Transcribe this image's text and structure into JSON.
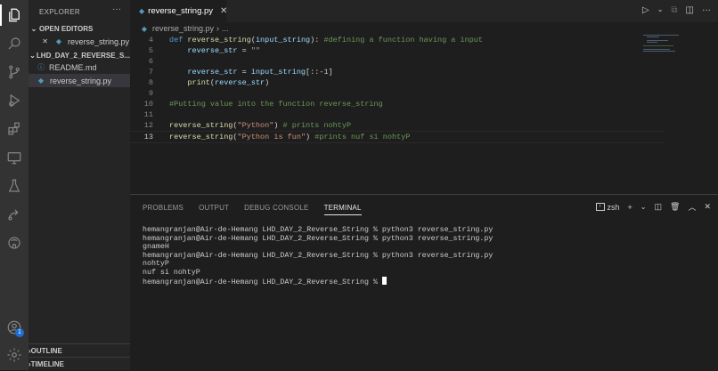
{
  "activity_bar": {
    "items": [
      "explorer-icon",
      "search-icon",
      "source-control-icon",
      "run-debug-icon",
      "extensions-icon",
      "remote-explorer-icon",
      "testing-icon",
      "live-share-icon",
      "github-icon"
    ],
    "bottom": [
      "account-icon",
      "settings-gear-icon"
    ],
    "account_badge": "1"
  },
  "sidebar": {
    "title": "EXPLORER",
    "more": "···",
    "open_editors": {
      "label": "OPEN EDITORS",
      "items": [
        {
          "close": "✕",
          "name": "reverse_string.py"
        }
      ]
    },
    "folder": {
      "label": "LHD_DAY_2_REVERSE_S...",
      "items": [
        {
          "name": "README.md",
          "type": "info"
        },
        {
          "name": "reverse_string.py",
          "type": "python",
          "selected": true
        }
      ]
    },
    "outline_label": "OUTLINE",
    "timeline_label": "TIMELINE"
  },
  "editor": {
    "tab_label": "reverse_string.py",
    "tab_close": "✕",
    "breadcrumb": "reverse_string.py",
    "breadcrumb_more": "...",
    "line_numbers": [
      "4",
      "5",
      "6",
      "7",
      "8",
      "9",
      "10",
      "11",
      "12",
      "13"
    ],
    "code_lines": [
      [
        {
          "t": "def ",
          "c": "kw"
        },
        {
          "t": "reverse_string",
          "c": "fn"
        },
        {
          "t": "(",
          "c": "txt"
        },
        {
          "t": "input_string",
          "c": "var"
        },
        {
          "t": "): ",
          "c": "txt"
        },
        {
          "t": "#defining a function having a input",
          "c": "cm"
        }
      ],
      [
        {
          "t": "    reverse_str",
          "c": "var"
        },
        {
          "t": " = ",
          "c": "txt"
        },
        {
          "t": "\"\"",
          "c": "str"
        }
      ],
      [],
      [
        {
          "t": "    reverse_str",
          "c": "var"
        },
        {
          "t": " = ",
          "c": "txt"
        },
        {
          "t": "input_string",
          "c": "var"
        },
        {
          "t": "[::-",
          "c": "txt"
        },
        {
          "t": "1",
          "c": "num"
        },
        {
          "t": "]",
          "c": "txt"
        }
      ],
      [
        {
          "t": "    print",
          "c": "fn"
        },
        {
          "t": "(",
          "c": "txt"
        },
        {
          "t": "reverse_str",
          "c": "var"
        },
        {
          "t": ")",
          "c": "txt"
        }
      ],
      [],
      [
        {
          "t": "#Putting value into the function reverse_string",
          "c": "cm"
        }
      ],
      [],
      [
        {
          "t": "reverse_string",
          "c": "fn"
        },
        {
          "t": "(",
          "c": "txt"
        },
        {
          "t": "\"Python\"",
          "c": "str"
        },
        {
          "t": ") ",
          "c": "txt"
        },
        {
          "t": "# prints nohtyP",
          "c": "cm"
        }
      ],
      [
        {
          "t": "reverse_string",
          "c": "fn"
        },
        {
          "t": "(",
          "c": "txt"
        },
        {
          "t": "\"Python is fun\"",
          "c": "str"
        },
        {
          "t": ") ",
          "c": "txt"
        },
        {
          "t": "#prints nuf si nohtyP",
          "c": "cm"
        }
      ]
    ],
    "current_line_index": 9
  },
  "panel": {
    "tabs": [
      {
        "label": "PROBLEMS",
        "active": false
      },
      {
        "label": "OUTPUT",
        "active": false
      },
      {
        "label": "DEBUG CONSOLE",
        "active": false
      },
      {
        "label": "TERMINAL",
        "active": true
      }
    ],
    "shell_label": "zsh",
    "terminal_lines": [
      "hemangranjan@Air-de-Hemang LHD_DAY_2_Reverse_String % python3 reverse_string.py",
      "hemangranjan@Air-de-Hemang LHD_DAY_2_Reverse_String % python3 reverse_string.py",
      "gnameH",
      "hemangranjan@Air-de-Hemang LHD_DAY_2_Reverse_String % python3 reverse_string.py",
      "nohtyP",
      "nuf si nohtyP"
    ],
    "prompt": "hemangranjan@Air-de-Hemang LHD_DAY_2_Reverse_String % "
  }
}
